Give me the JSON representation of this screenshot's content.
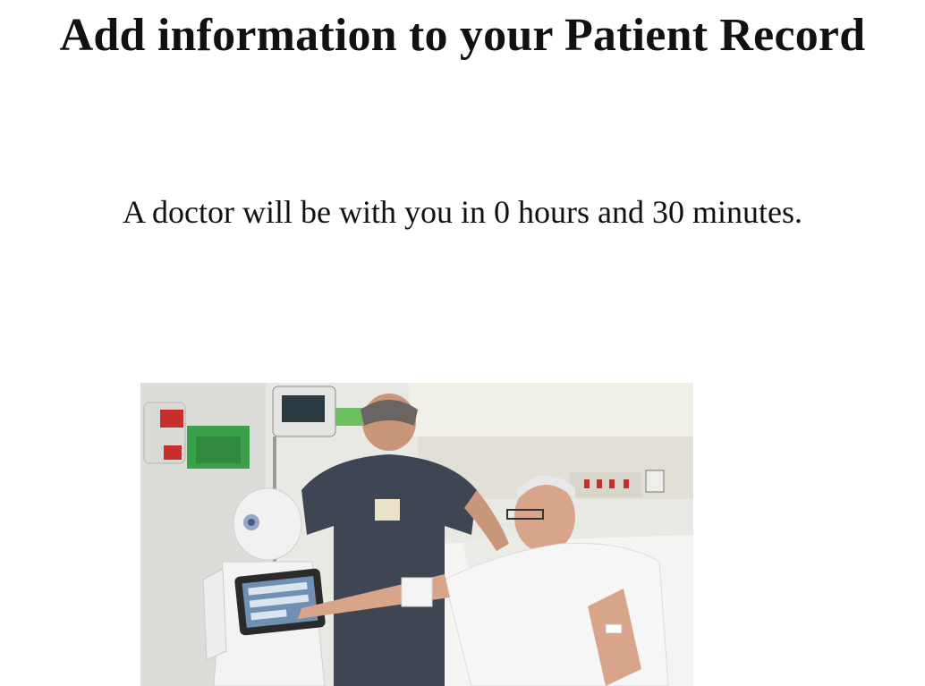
{
  "header": {
    "title": "Add information to your Patient Record"
  },
  "status": {
    "wait_message": "A doctor will be with you in 0 hours and 30 minutes."
  },
  "photo": {
    "subject": "robot-tablet-patient-nurse-photo"
  }
}
